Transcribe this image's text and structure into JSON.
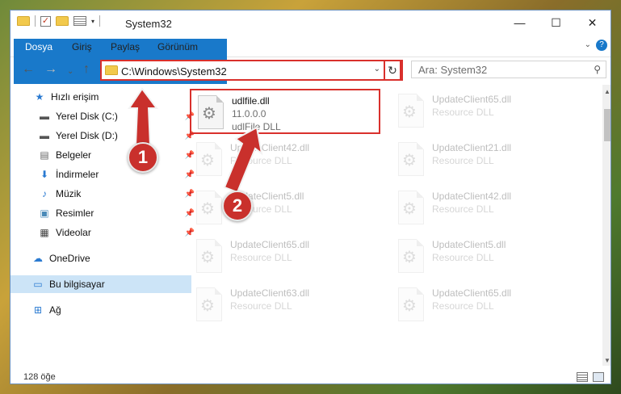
{
  "titlebar": {
    "title": "System32",
    "minimize_icon": "minimize-icon",
    "maximize_icon": "maximize-icon",
    "close_icon": "close-icon"
  },
  "ribbon": {
    "tabs": [
      {
        "label": "Dosya"
      },
      {
        "label": "Giriş"
      },
      {
        "label": "Paylaş"
      },
      {
        "label": "Görünüm"
      }
    ]
  },
  "navbar": {
    "address": "C:\\Windows\\System32",
    "search_placeholder": "Ara: System32"
  },
  "sidebar": {
    "items": [
      {
        "label": "Hızlı erişim",
        "icon": "star-icon"
      },
      {
        "label": "Yerel Disk (C:)",
        "icon": "drive-icon"
      },
      {
        "label": "Yerel Disk (D:)",
        "icon": "drive-icon"
      },
      {
        "label": "Belgeler",
        "icon": "documents-icon"
      },
      {
        "label": "İndirmeler",
        "icon": "download-icon"
      },
      {
        "label": "Müzik",
        "icon": "music-icon"
      },
      {
        "label": "Resimler",
        "icon": "pictures-icon"
      },
      {
        "label": "Videolar",
        "icon": "videos-icon"
      },
      {
        "label": "OneDrive",
        "icon": "cloud-icon"
      },
      {
        "label": "Bu bilgisayar",
        "icon": "computer-icon"
      },
      {
        "label": "Ağ",
        "icon": "network-icon"
      }
    ]
  },
  "files": [
    {
      "name": "udlfile.dll",
      "version": "11.0.0.0",
      "desc": "udlFile DLL"
    },
    {
      "name": "UpdateClient65.dll",
      "desc": "Resource DLL"
    },
    {
      "name": "UpdateClient42.dll",
      "desc": "Resource DLL"
    },
    {
      "name": "UpdateClient21.dll",
      "desc": "Resource DLL"
    },
    {
      "name": "UpdateClient5.dll",
      "desc": "Resource DLL"
    },
    {
      "name": "UpdateClient42.dll",
      "desc": "Resource DLL"
    },
    {
      "name": "UpdateClient65.dll",
      "desc": "Resource DLL"
    },
    {
      "name": "UpdateClient5.dll",
      "desc": "Resource DLL"
    },
    {
      "name": "UpdateClient63.dll",
      "desc": "Resource DLL"
    },
    {
      "name": "UpdateClient65.dll",
      "desc": "Resource DLL"
    }
  ],
  "status": {
    "item_count": "128 öğe"
  },
  "annotations": {
    "badge1": "1",
    "badge2": "2",
    "color": "#c9302c"
  }
}
